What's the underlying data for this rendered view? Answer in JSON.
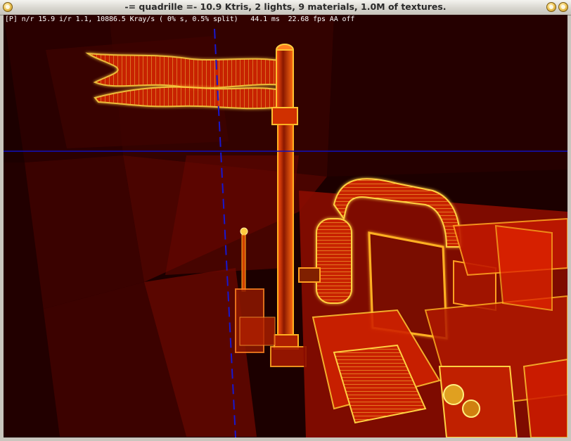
{
  "window": {
    "title": "-= quadrille =-  10.9 Ktris, 2 lights, 9 materials, 1.0M of textures."
  },
  "titlebar_buttons": {
    "menu_icon": "window-menu-icon",
    "minimize_icon": "minimize-icon",
    "close_icon": "close-icon",
    "button_color": "#e8b840"
  },
  "hud": {
    "stats": "[P] n/r 15.9 i/r 1.1, 10886.5 Kray/s ( 0% s, 0.5% split)   44.1 ms  22.68 fps AA off"
  },
  "colors": {
    "background": "#1a0000",
    "wire_hot": "#ffd040",
    "surface": "#c01800",
    "guide_line": "#1010c0"
  }
}
